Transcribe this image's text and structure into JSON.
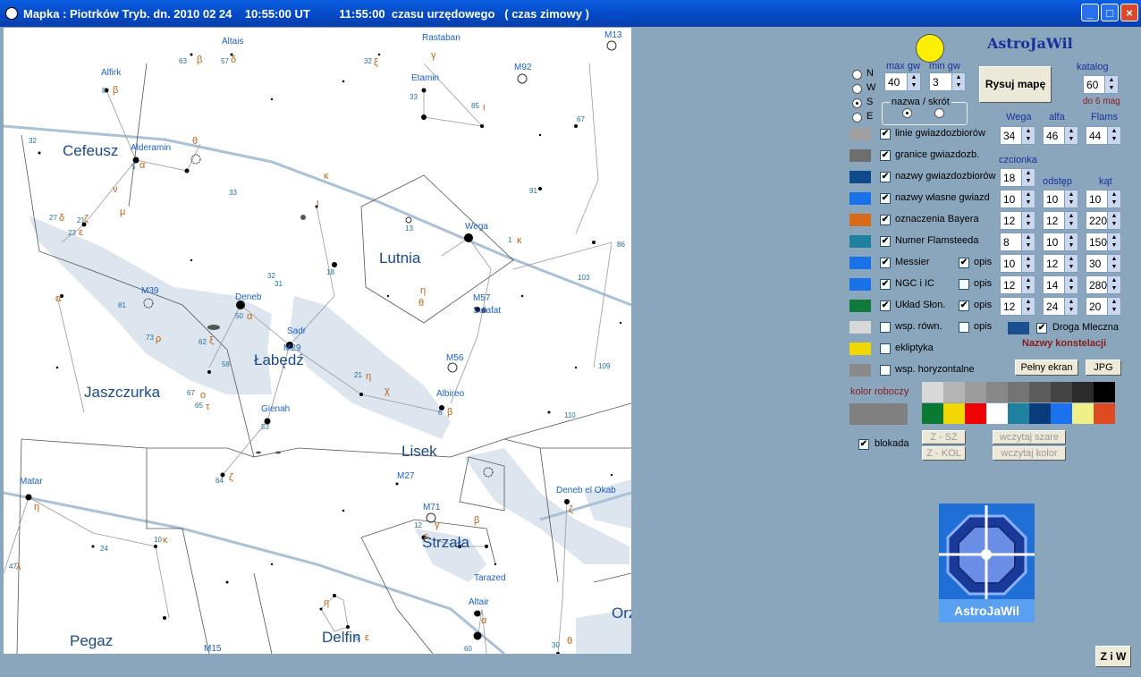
{
  "window": {
    "title": "Mapka : Piotrków Tryb. dn. 2010 02 24    10:55:00 UT         11:55:00  czasu urzędowego   ( czas zimowy )",
    "minimize": "_",
    "maximize": "□",
    "close": "×"
  },
  "map": {
    "constellations": [
      "Cefeusz",
      "Lutnia",
      "Łabędź",
      "Jaszczurka",
      "Lisek",
      "Strzała",
      "Pegaz",
      "Delfin",
      "Orz"
    ],
    "star_names": [
      "Altais",
      "Rastaban",
      "Alfirk",
      "Alderamin",
      "Etamin",
      "Wega",
      "Deneb",
      "Sadr",
      "Sulafat",
      "Albireo",
      "Gienah",
      "Matar",
      "Deneb el Okab",
      "Tarazed",
      "Altair"
    ],
    "messier": [
      "M13",
      "M92",
      "M39",
      "M29",
      "M57",
      "M56",
      "M27",
      "M71",
      "M15"
    ],
    "bayer": [
      "β",
      "δ",
      "ξ",
      "γ",
      "β",
      "α",
      "ι",
      "θ",
      "ν",
      "μ",
      "κ",
      "ζ",
      "α",
      "δ",
      "ε",
      "κ",
      "η",
      "θ",
      "ρ",
      "α",
      "ξ",
      "ο",
      "τ",
      "χ",
      "β",
      "η",
      "ι",
      "η",
      "ζ",
      "κ",
      "λ",
      "γ",
      "β",
      "ζ",
      "η",
      "θ",
      "ε",
      "α",
      "ε"
    ],
    "flamsteed": [
      "63",
      "57",
      "32",
      "33",
      "8",
      "32",
      "5",
      "33",
      "85",
      "67",
      "21",
      "27",
      "23",
      "91",
      "13",
      "1",
      "86",
      "103",
      "81",
      "73",
      "62",
      "58",
      "50",
      "32",
      "31",
      "18",
      "65",
      "67",
      "53",
      "64",
      "21",
      "6",
      "110",
      "109",
      "10",
      "12",
      "24",
      "47",
      "5",
      "60",
      "30"
    ]
  },
  "panel": {
    "app_name": "AstroJaWil",
    "directions": [
      "N",
      "W",
      "S",
      "E"
    ],
    "direction_selected": "S",
    "max_gw_label": "max gw",
    "min_gw_label": "min gw",
    "max_gw": "40",
    "min_gw": "3",
    "draw_button": "Rysuj mapę",
    "catalog_label": "katalog",
    "catalog_value": "60",
    "catalog_note": "do 6 mag",
    "name_group_label": "nazwa / skrót",
    "col_wega": "Wega",
    "col_alfa": "alfa",
    "col_flams": "Flams",
    "wega_val": "34",
    "alfa_val": "46",
    "flams_val": "44",
    "font_label": "czcionka",
    "offset_label": "odstęp",
    "angle_label": "kąt",
    "layers": [
      {
        "label": "linie gwiazdozbiorów",
        "color": "#a0a0a0",
        "checked": "✔",
        "font": "",
        "offset": "",
        "angle": ""
      },
      {
        "label": "granice gwiazdozb.",
        "color": "#6e6e6e",
        "checked": "✔",
        "font": "",
        "offset": "",
        "angle": ""
      },
      {
        "label": "nazwy gwiazdozbiorów",
        "color": "#0f4a8c",
        "checked": "✔",
        "font": "18",
        "offset": "",
        "angle": ""
      },
      {
        "label": "nazwy własne gwiazd",
        "color": "#1a72e8",
        "checked": "✔",
        "font": "10",
        "offset": "10",
        "angle": "10"
      },
      {
        "label": "oznaczenia Bayera",
        "color": "#d86a1a",
        "checked": "✔",
        "font": "12",
        "offset": "12",
        "angle": "220"
      },
      {
        "label": "Numer Flamsteeda",
        "color": "#1f80a0",
        "checked": "✔",
        "font": "8",
        "offset": "10",
        "angle": "150"
      },
      {
        "label": "Messier",
        "color": "#1a72e8",
        "checked": "✔",
        "opis": "✔",
        "font": "10",
        "offset": "12",
        "angle": "30"
      },
      {
        "label": "NGC  i  IC",
        "color": "#1a72e8",
        "checked": "✔",
        "opis": "",
        "font": "12",
        "offset": "14",
        "angle": "280"
      },
      {
        "label": "Układ Słon.",
        "color": "#0f7a3a",
        "checked": "✔",
        "opis": "✔",
        "font": "12",
        "offset": "24",
        "angle": "20"
      },
      {
        "label": "wsp. równ.",
        "color": "#d8d8d8",
        "checked": "",
        "opis": "",
        "font": "",
        "offset": "",
        "angle": ""
      },
      {
        "label": "ekliptyka",
        "color": "#f0d800",
        "checked": "",
        "font": "",
        "offset": "",
        "angle": ""
      },
      {
        "label": "wsp. horyzontalne",
        "color": "#8a8a8a",
        "checked": "",
        "font": "",
        "offset": "",
        "angle": ""
      }
    ],
    "opis_label": "opis",
    "milky_way_label": "Droga Mleczna",
    "milky_way_checked": "✔",
    "milky_way_color": "#1a5090",
    "constellation_names_label": "Nazwy konstelacji",
    "fullscreen_button": "Pełny ekran",
    "jpg_button": "JPG",
    "working_color_label": "kolor roboczy",
    "working_color": "#808080",
    "palette_row1": [
      "#d8d8d8",
      "#b4b4b4",
      "#9c9c9c",
      "#888888",
      "#747474",
      "#5c5c5c",
      "#444444",
      "#2c2c2c",
      "#000000"
    ],
    "palette_row2": [
      "#0a7a32",
      "#f0d800",
      "#f00000",
      "#ffffff",
      "#2080a0",
      "#0a3c7c",
      "#1a72f0",
      "#f0f088",
      "#e04a20"
    ],
    "lock_label": "blokada",
    "lock_checked": "✔",
    "z_sz_button": "Z - SZ",
    "z_kol_button": "Z - KOL",
    "load_gray_button": "wczytaj szare",
    "load_color_button": "wczytaj kolor",
    "logo_text": "AstroJaWil",
    "ziw_button": "Z i W"
  }
}
